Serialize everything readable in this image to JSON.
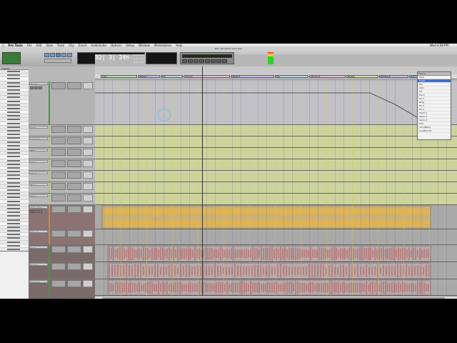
{
  "menubar": {
    "apple": "",
    "app": "Pro Tools",
    "items": [
      "File",
      "Edit",
      "View",
      "Track",
      "Clip",
      "Event",
      "AudioSuite",
      "Options",
      "Setup",
      "Window",
      "Marketplace",
      "Help"
    ],
    "clock": "Wed 4:08 PM"
  },
  "window": {
    "title": "Edit: Wonderful Love New"
  },
  "counter": {
    "main": "32| 3| 246",
    "start_label": "Start",
    "end_label": "End",
    "length_label": "Length",
    "start": "0:00.000",
    "end": "0:00.000",
    "length": "0:00.000"
  },
  "tracks_panel": {
    "title": "TRACKS"
  },
  "tracks": [
    {
      "name": "Master",
      "type": "aux"
    },
    {
      "name": "Click",
      "type": "aux"
    },
    {
      "name": "Lead Vox",
      "type": "aux"
    },
    {
      "name": "BGV",
      "type": "aux"
    },
    {
      "name": "Gtr 1",
      "type": "aux"
    },
    {
      "name": "Gtr 2",
      "type": "aux"
    },
    {
      "name": "Bass",
      "type": "aux"
    },
    {
      "name": "Piano",
      "type": "aux"
    },
    {
      "name": "Piano Verb",
      "type": "audio"
    },
    {
      "name": "Piano R",
      "type": "audio"
    },
    {
      "name": "Snap",
      "type": "audio"
    },
    {
      "name": "Kick In",
      "type": "audio"
    },
    {
      "name": "Kick Out",
      "type": "audio"
    }
  ],
  "markers": [
    "Intro",
    "Verse 1",
    "Pre",
    "Chorus",
    "Verse 2",
    "Pre",
    "Chorus 2",
    "Bridge",
    "Chorus 3",
    "Outro"
  ],
  "memory_locations": {
    "title": "Name",
    "items": [
      "Intro",
      "Verse",
      "Pre",
      "Chor",
      "V2",
      "Pre 2",
      "Ch 2",
      "Brdg",
      "Ch 3",
      "Ch 4",
      "Outro 1",
      "Outro 2",
      "Outro 3",
      "End",
      "Tim (Back)",
      "Location 22"
    ],
    "selected_index": 1
  },
  "colors": {
    "audio_wave": "#e7b54a",
    "drum_hits": "#b33a3a",
    "aux_lane": "#cdd39c",
    "playhead": "#333333"
  }
}
